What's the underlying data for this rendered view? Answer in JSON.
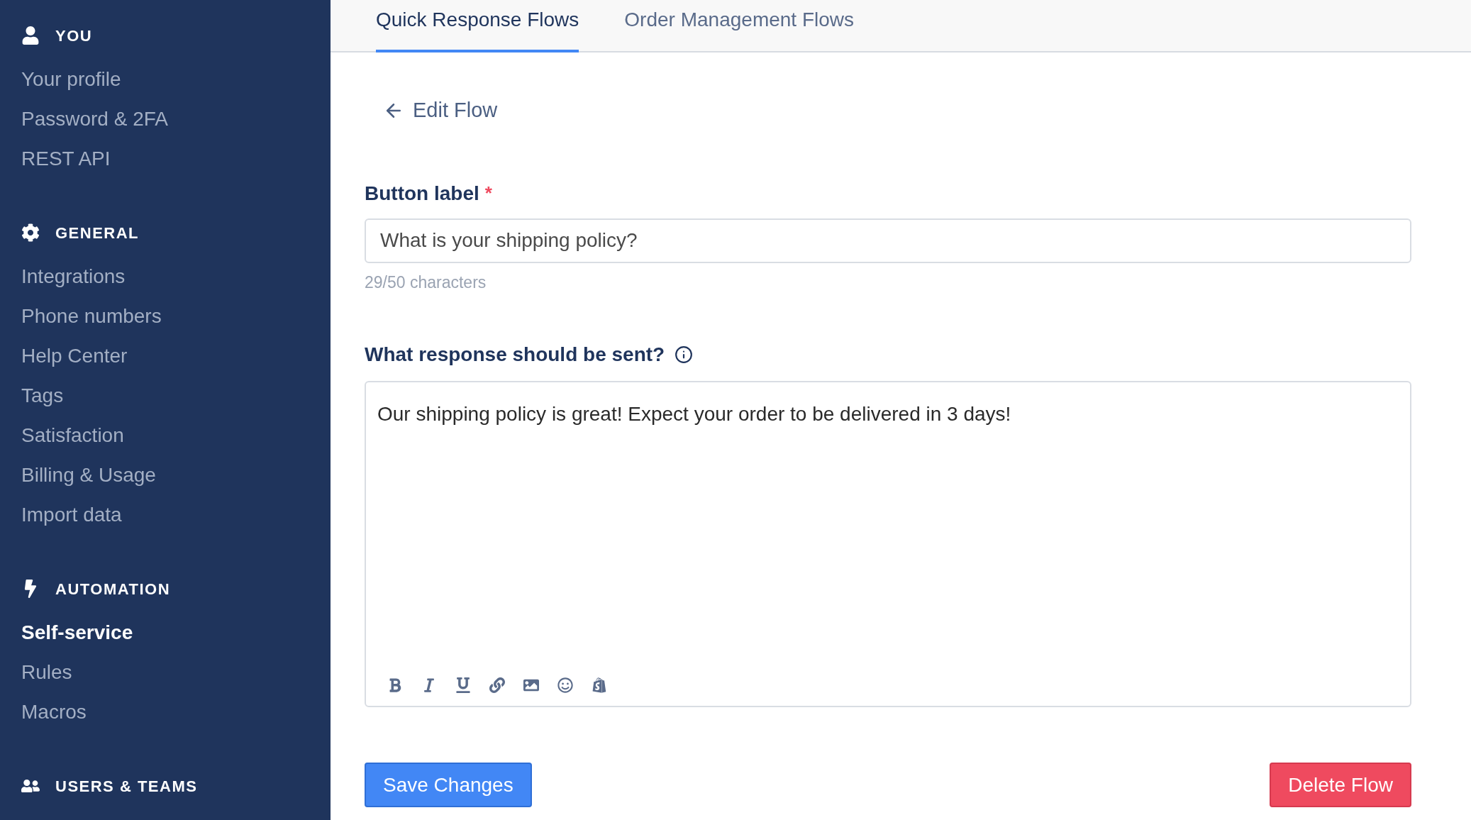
{
  "sidebar": {
    "sections": [
      {
        "kind": "user",
        "title": "YOU",
        "items": [
          {
            "label": "Your profile",
            "selected": false
          },
          {
            "label": "Password & 2FA",
            "selected": false
          },
          {
            "label": "REST API",
            "selected": false
          }
        ]
      },
      {
        "kind": "gear",
        "title": "GENERAL",
        "items": [
          {
            "label": "Integrations",
            "selected": false
          },
          {
            "label": "Phone numbers",
            "selected": false
          },
          {
            "label": "Help Center",
            "selected": false
          },
          {
            "label": "Tags",
            "selected": false
          },
          {
            "label": "Satisfaction",
            "selected": false
          },
          {
            "label": "Billing & Usage",
            "selected": false
          },
          {
            "label": "Import data",
            "selected": false
          }
        ]
      },
      {
        "kind": "bolt",
        "title": "AUTOMATION",
        "items": [
          {
            "label": "Self-service",
            "selected": true
          },
          {
            "label": "Rules",
            "selected": false
          },
          {
            "label": "Macros",
            "selected": false
          }
        ]
      },
      {
        "kind": "users",
        "title": "USERS & TEAMS"
      }
    ]
  },
  "tabs": [
    {
      "label": "Quick Response Flows",
      "selected": true
    },
    {
      "label": "Order Management Flows",
      "selected": false
    }
  ],
  "back_link": "Edit Flow",
  "button_label_field": {
    "label": "Button label",
    "required_mark": "*",
    "value": "What is your shipping policy?",
    "counter": "29/50 characters"
  },
  "response_field": {
    "label": "What response should be sent?",
    "value": "Our shipping policy is great! Expect your order to be delivered in 3 days!",
    "toolbar": [
      {
        "kind": "bold"
      },
      {
        "kind": "italic"
      },
      {
        "kind": "underline"
      },
      {
        "kind": "link"
      },
      {
        "kind": "image"
      },
      {
        "kind": "emoji"
      },
      {
        "kind": "shop"
      }
    ]
  },
  "actions": {
    "save": "Save Changes",
    "delete": "Delete Flow"
  }
}
